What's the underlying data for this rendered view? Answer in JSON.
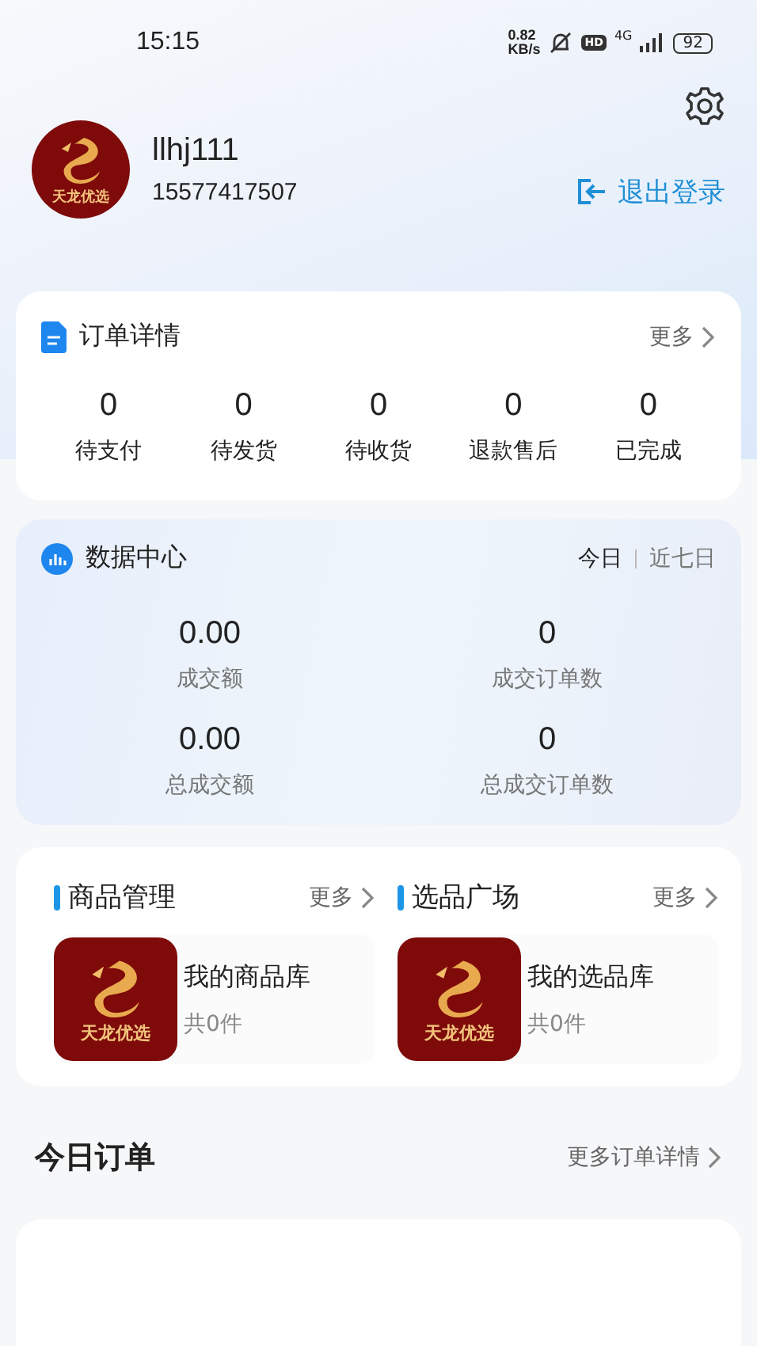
{
  "status_bar": {
    "time": "15:15",
    "net_speed_value": "0.82",
    "net_speed_unit": "KB/s",
    "hd": "HD",
    "network": "4G",
    "battery": "92"
  },
  "profile": {
    "logo_text": "天龙优选",
    "username": "llhj111",
    "phone": "15577417507",
    "logout": "退出登录"
  },
  "orders": {
    "title": "订单详情",
    "more": "更多",
    "stats": [
      {
        "value": "0",
        "label": "待支付"
      },
      {
        "value": "0",
        "label": "待发货"
      },
      {
        "value": "0",
        "label": "待收货"
      },
      {
        "value": "0",
        "label": "退款售后"
      },
      {
        "value": "0",
        "label": "已完成"
      }
    ]
  },
  "data_center": {
    "title": "数据中心",
    "periods": [
      {
        "label": "今日",
        "selected": true
      },
      {
        "label": "近七日",
        "selected": false
      }
    ],
    "metrics": [
      {
        "value": "0.00",
        "label": "成交额"
      },
      {
        "value": "0",
        "label": "成交订单数"
      },
      {
        "value": "0.00",
        "label": "总成交额"
      },
      {
        "value": "0",
        "label": "总成交订单数"
      }
    ]
  },
  "sections": [
    {
      "title": "商品管理",
      "more": "更多",
      "logo_text": "天龙优选",
      "name": "我的商品库",
      "count": "共0件"
    },
    {
      "title": "选品广场",
      "more": "更多",
      "logo_text": "天龙优选",
      "name": "我的选品库",
      "count": "共0件"
    }
  ],
  "today_orders": {
    "title": "今日订单",
    "more": "更多订单详情"
  }
}
